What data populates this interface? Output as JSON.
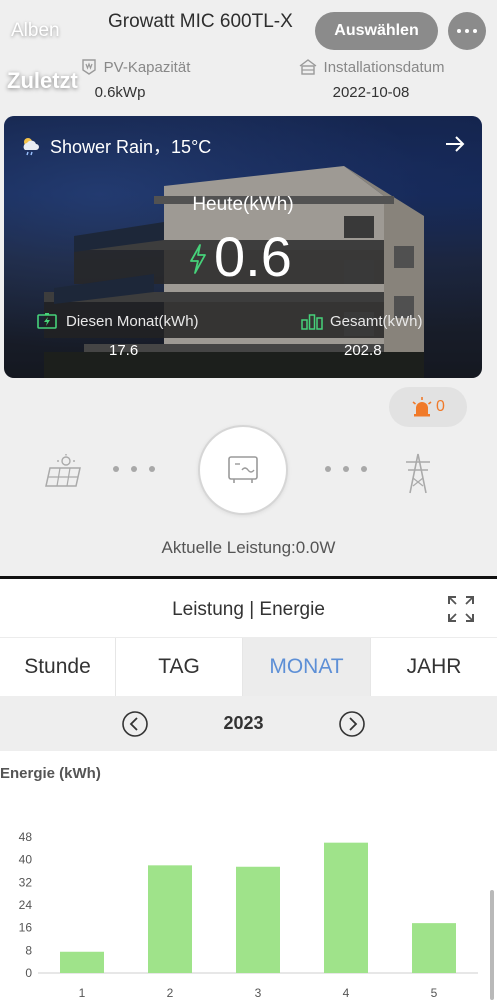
{
  "overlay": {
    "back_label": "Alben",
    "app_title": "Growatt MIC 600TL-X",
    "select_label": "Auswählen",
    "more_icon": "ellipsis-icon",
    "album_label": "Zuletzt"
  },
  "plant": {
    "capacity_label": "PV-Kapazität",
    "capacity_value": "0.6kWp",
    "install_label": "Installationsdatum",
    "install_value": "2022-10-08"
  },
  "card": {
    "weather_text": "Shower Rain，15°C",
    "today_label": "Heute(kWh)",
    "today_value": "0.6",
    "month_label": "Diesen Monat(kWh)",
    "month_value": "17.6",
    "total_label": "Gesamt(kWh)",
    "total_value": "202.8"
  },
  "alarm": {
    "count": "0"
  },
  "flow": {
    "current_power": "Aktuelle Leistung:0.0W"
  },
  "panel": {
    "title": "Leistung | Energie",
    "tabs": [
      "Stunde",
      "TAG",
      "MONAT",
      "JAHR"
    ],
    "active_tab": "MONAT",
    "year": "2023"
  },
  "colors": {
    "bar": "#9fe38a",
    "active_tab": "#5d8fd6",
    "alarm": "#f07a2a"
  },
  "chart_data": {
    "type": "bar",
    "ylabel": "Energie (kWh)",
    "categories": [
      "1",
      "2",
      "3",
      "4",
      "5"
    ],
    "values": [
      7.5,
      38,
      37.5,
      46,
      17.6
    ],
    "ylim": [
      0,
      48
    ],
    "yticks": [
      0,
      8,
      16,
      24,
      32,
      40,
      48
    ]
  }
}
